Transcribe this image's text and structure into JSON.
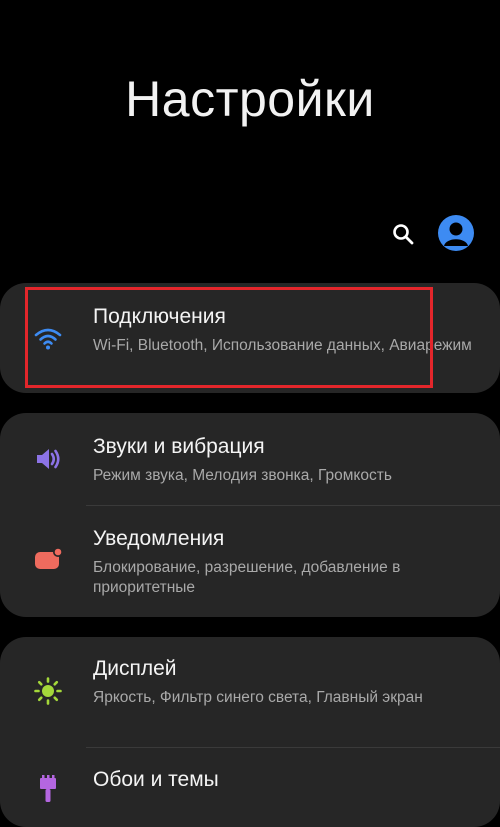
{
  "header": {
    "title": "Настройки"
  },
  "toolbar": {
    "search_icon": "search-icon",
    "profile_icon": "account-icon"
  },
  "groups": [
    {
      "items": [
        {
          "title": "Подключения",
          "subtitle": "Wi-Fi, Bluetooth, Использование данных, Авиарежим",
          "icon": "wifi-icon",
          "icon_color": "#3d8bf2"
        }
      ]
    },
    {
      "items": [
        {
          "title": "Звуки и вибрация",
          "subtitle": "Режим звука, Мелодия звонка, Громкость",
          "icon": "speaker-icon",
          "icon_color": "#8c73e6"
        },
        {
          "title": "Уведомления",
          "subtitle": "Блокирование, разрешение, добавление в приоритетные",
          "icon": "notification-icon",
          "icon_color": "#ee6b5e"
        }
      ]
    },
    {
      "items": [
        {
          "title": "Дисплей",
          "subtitle": "Яркость, Фильтр синего света, Главный экран",
          "icon": "brightness-icon",
          "icon_color": "#a4d83a"
        },
        {
          "title": "Обои и темы",
          "subtitle": "",
          "icon": "brush-icon",
          "icon_color": "#b466e0"
        }
      ]
    }
  ],
  "colors": {
    "background": "#000000",
    "card": "#262626",
    "highlight": "#e3262b",
    "accent": "#3d8bf2"
  }
}
